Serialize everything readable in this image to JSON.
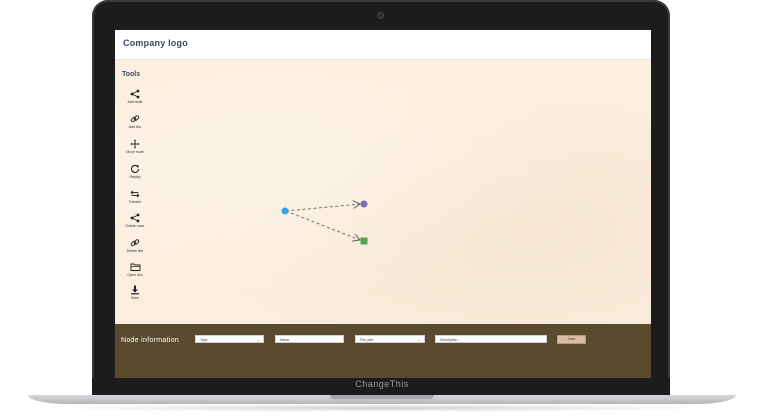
{
  "app": {
    "logo": "Company logo",
    "tools_title": "Tools",
    "tools": [
      {
        "label": "Add node",
        "icon": "add-node-icon"
      },
      {
        "label": "Add link",
        "icon": "link-icon"
      },
      {
        "label": "Move node",
        "icon": "move-icon"
      },
      {
        "label": "Replay",
        "icon": "replay-icon"
      },
      {
        "label": "Transfer",
        "icon": "transfer-icon"
      },
      {
        "label": "Delete node",
        "icon": "delete-node-icon"
      },
      {
        "label": "Delete link",
        "icon": "delete-link-icon"
      },
      {
        "label": "Open doc",
        "icon": "folder-icon"
      },
      {
        "label": "Save",
        "icon": "download-icon"
      }
    ],
    "node_info": {
      "title": "Node information",
      "type_placeholder": "Type",
      "name_placeholder": "Name",
      "file_path_placeholder": "File path",
      "description_placeholder": "Description",
      "save_label": "Save"
    },
    "graph": {
      "source_node_color": "#2fa3e6",
      "target_circle_color": "#7a6fb0",
      "target_square_color": "#5aa05a",
      "link_color": "#666666"
    }
  },
  "device": {
    "brand": "ChangeThis"
  }
}
